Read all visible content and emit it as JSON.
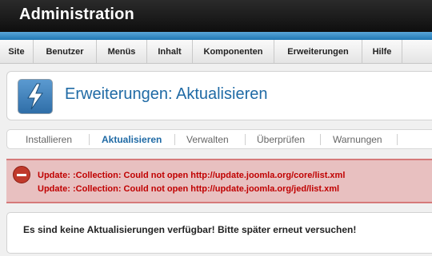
{
  "header": {
    "title": "Administration"
  },
  "menu": {
    "items": [
      {
        "label": "Site"
      },
      {
        "label": "Benutzer"
      },
      {
        "label": "Menüs"
      },
      {
        "label": "Inhalt"
      },
      {
        "label": "Komponenten"
      },
      {
        "label": "Erweiterungen"
      },
      {
        "label": "Hilfe"
      }
    ]
  },
  "toolbar": {
    "title": "Erweiterungen: Aktualisieren",
    "icon": "lightning-icon"
  },
  "subnav": {
    "items": [
      {
        "label": "Installieren",
        "active": false
      },
      {
        "label": "Aktualisieren",
        "active": true
      },
      {
        "label": "Verwalten",
        "active": false
      },
      {
        "label": "Überprüfen",
        "active": false
      },
      {
        "label": "Warnungen",
        "active": false
      }
    ]
  },
  "errors": {
    "icon": "error-icon",
    "lines": [
      "Update: :Collection: Could not open http://update.joomla.org/core/list.xml",
      "Update: :Collection: Could not open http://update.joomla.org/jed/list.xml"
    ]
  },
  "message": {
    "text": "Es sind keine Aktualisierungen verfügbar! Bitte später erneut versuchen!"
  },
  "colors": {
    "accent": "#1f6aa5",
    "header_bg": "#1a1a1a",
    "stripe": "#1f78b4",
    "error_bg": "#e8c0c0",
    "error_text": "#c00000"
  }
}
